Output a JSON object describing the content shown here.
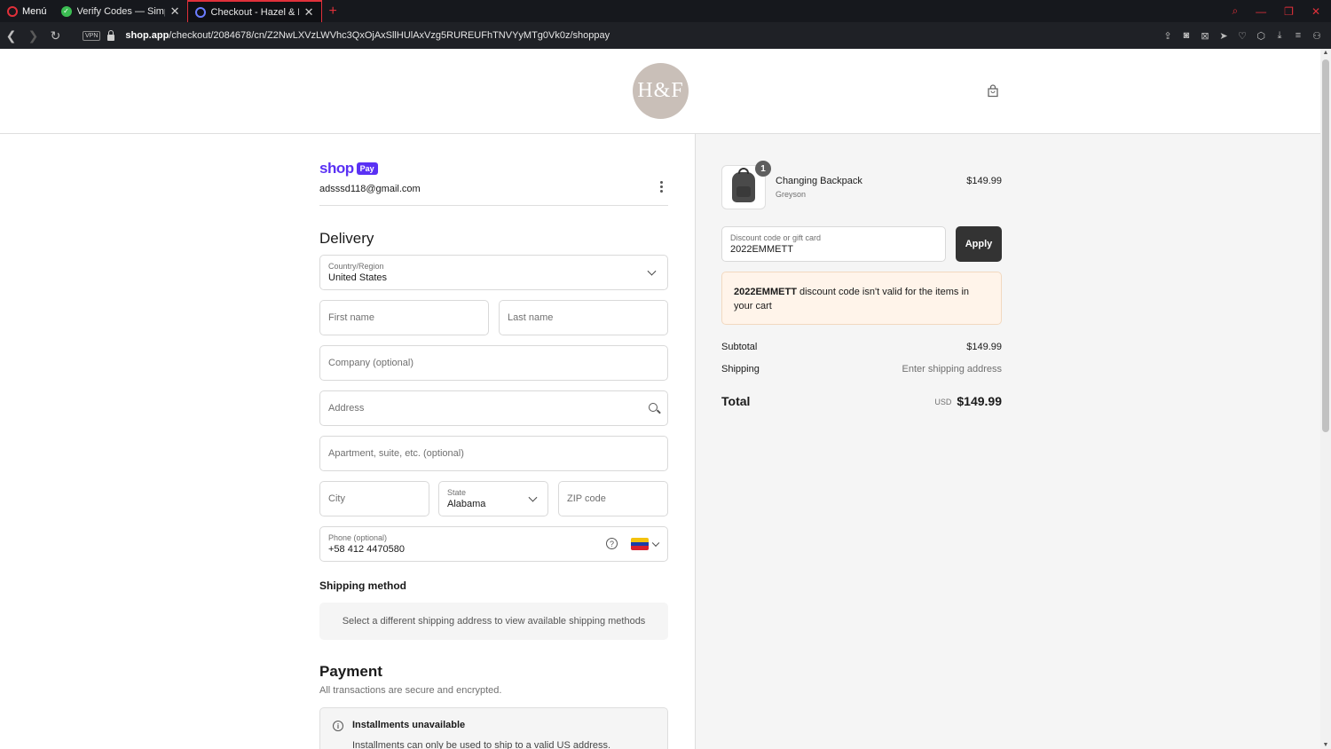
{
  "browser": {
    "menu_label": "Menú",
    "tabs": [
      {
        "title": "Verify Codes — SimplyCodes",
        "active": false
      },
      {
        "title": "Checkout - Hazel & Fawn",
        "active": true
      }
    ],
    "new_tab": "+",
    "vpn_badge": "VPN",
    "url_host": "shop.app",
    "url_path": "/checkout/2084678/cn/Z2NwLXVzLWVhc3QxOjAxSllHUlAxVzg5RUREUFhTNVYyMTg0Vk0z/shoppay",
    "accent_color": "#e0303a"
  },
  "header": {
    "logo_text": "H&F"
  },
  "shoppay": {
    "brand_word": "shop",
    "brand_pill": "Pay",
    "email": "adsssd118@gmail.com",
    "brand_color": "#5a31f4"
  },
  "delivery": {
    "heading": "Delivery",
    "country_label": "Country/Region",
    "country_value": "United States",
    "first_name_placeholder": "First name",
    "last_name_placeholder": "Last name",
    "company_placeholder": "Company (optional)",
    "address_placeholder": "Address",
    "apartment_placeholder": "Apartment, suite, etc. (optional)",
    "city_placeholder": "City",
    "state_label": "State",
    "state_value": "Alabama",
    "zip_placeholder": "ZIP code",
    "phone_label": "Phone (optional)",
    "phone_value": "+58 412 4470580",
    "help_glyph": "?"
  },
  "shipping_method": {
    "heading": "Shipping method",
    "message": "Select a different shipping address to view available shipping methods"
  },
  "payment": {
    "heading": "Payment",
    "subtitle": "All transactions are secure and encrypted.",
    "installments_title": "Installments unavailable",
    "installments_text": "Installments can only be used to ship to a valid US address.",
    "info_glyph": "i"
  },
  "order": {
    "item": {
      "quantity": "1",
      "name": "Changing Backpack",
      "variant": "Greyson",
      "price": "$149.99"
    },
    "discount_label": "Discount code or gift card",
    "discount_value": "2022EMMETT",
    "apply_label": "Apply",
    "error_code": "2022EMMETT",
    "error_message": " discount code isn't valid for the items in your cart",
    "subtotal_label": "Subtotal",
    "subtotal_value": "$149.99",
    "shipping_label": "Shipping",
    "shipping_value": "Enter shipping address",
    "total_label": "Total",
    "total_currency": "USD",
    "total_value": "$149.99"
  }
}
